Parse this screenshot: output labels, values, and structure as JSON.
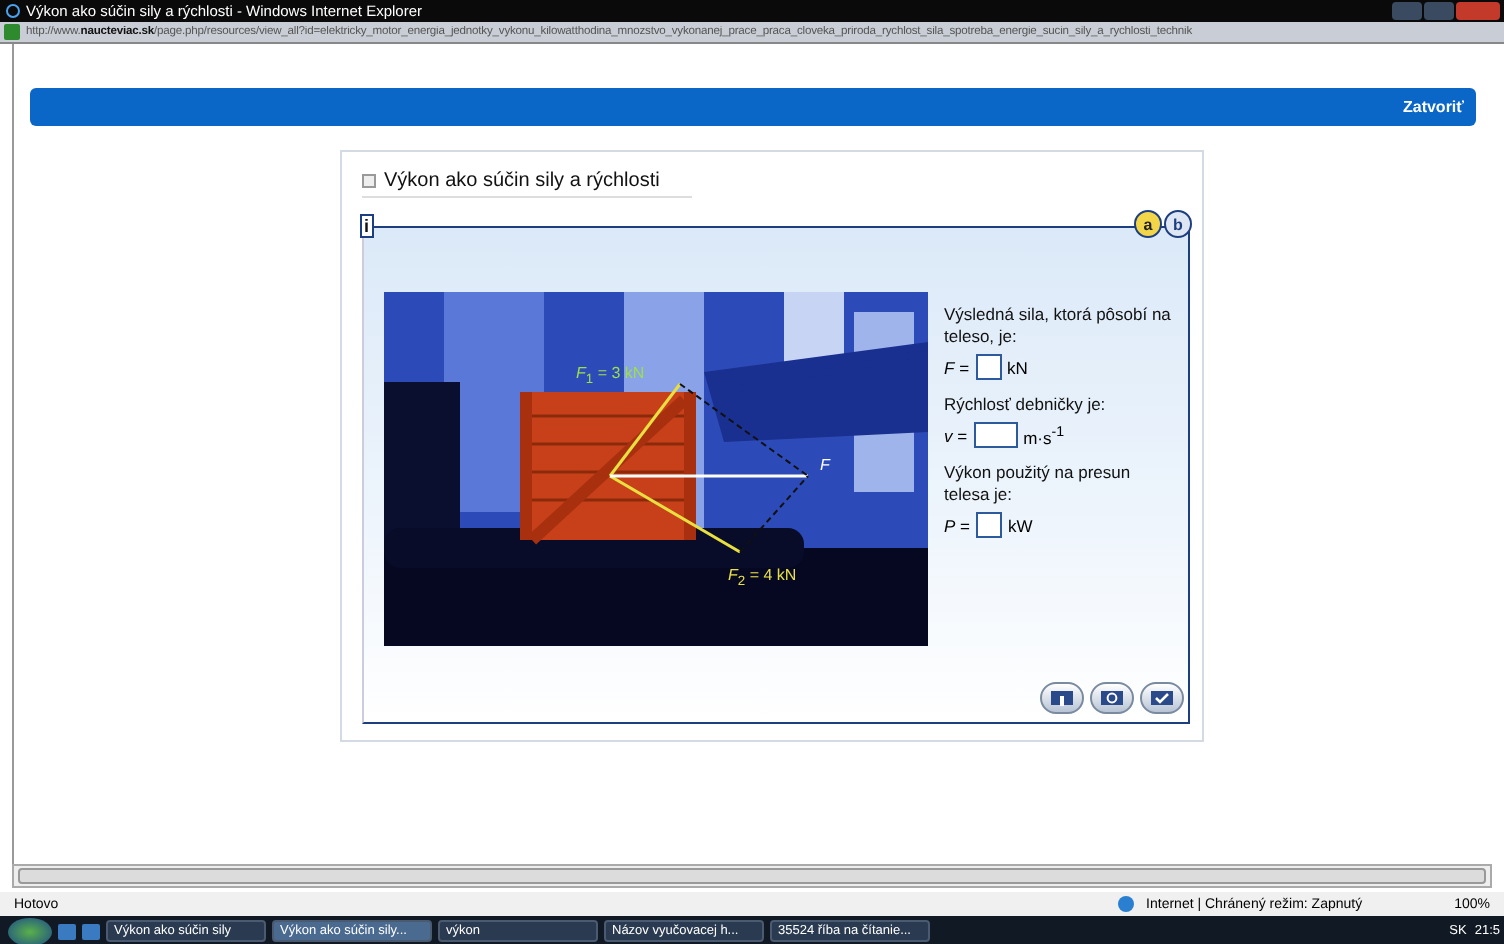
{
  "window": {
    "title": "Výkon ako súčin sily a rýchlosti - Windows Internet Explorer"
  },
  "address_bar": {
    "url_prefix": "http://www.",
    "url_domain": "naucteviac.sk",
    "url_rest": "/page.php/resources/view_all?id=elektricky_motor_energia_jednotky_vykonu_kilowatthodina_mnozstvo_vykonanej_prace_praca_cloveka_priroda_rychlost_sila_spotreba_energie_sucin_sily_a_rychlosti_technik"
  },
  "header_bar": {
    "close_link": "Zatvoriť"
  },
  "card": {
    "title": "Výkon ako súčin sily a rýchlosti",
    "info": "i",
    "variant_tabs": [
      {
        "label": "a",
        "selected": true
      },
      {
        "label": "b",
        "selected": false
      }
    ],
    "illustration": {
      "labels": [
        "*F*$_{1}$ = 3 kN",
        "*F*$_{2}$ = 4 kN",
        "*F*"
      ]
    },
    "questions": [
      {
        "text": "Výsledná sila, ktorá pôsobí na teleso, je:",
        "variable": "*F* =",
        "unit": "kN"
      },
      {
        "text": "Rýchlosť debničky je:",
        "variable": "*v* =",
        "unit": "m·s$^{-1}$"
      },
      {
        "text": "Výkon použitý na presun telesa je:",
        "variable": "*P* =",
        "unit": "kW"
      }
    ]
  },
  "status_bar": {
    "text": "Hotovo",
    "zone": "Internet | Chránený režim: Zapnutý",
    "zoom": "100%"
  },
  "taskbar": {
    "items": [
      {
        "label": "Výkon ako súčin sily",
        "selected": false
      },
      {
        "label": "Výkon ako súčin sily...",
        "selected": true
      },
      {
        "label": "výkon",
        "selected": false
      },
      {
        "label": "Názov vyučovacej h...",
        "selected": false
      },
      {
        "label": "35524 říba na čítanie...",
        "selected": false
      }
    ],
    "language": "SK",
    "clock": "21:5"
  }
}
